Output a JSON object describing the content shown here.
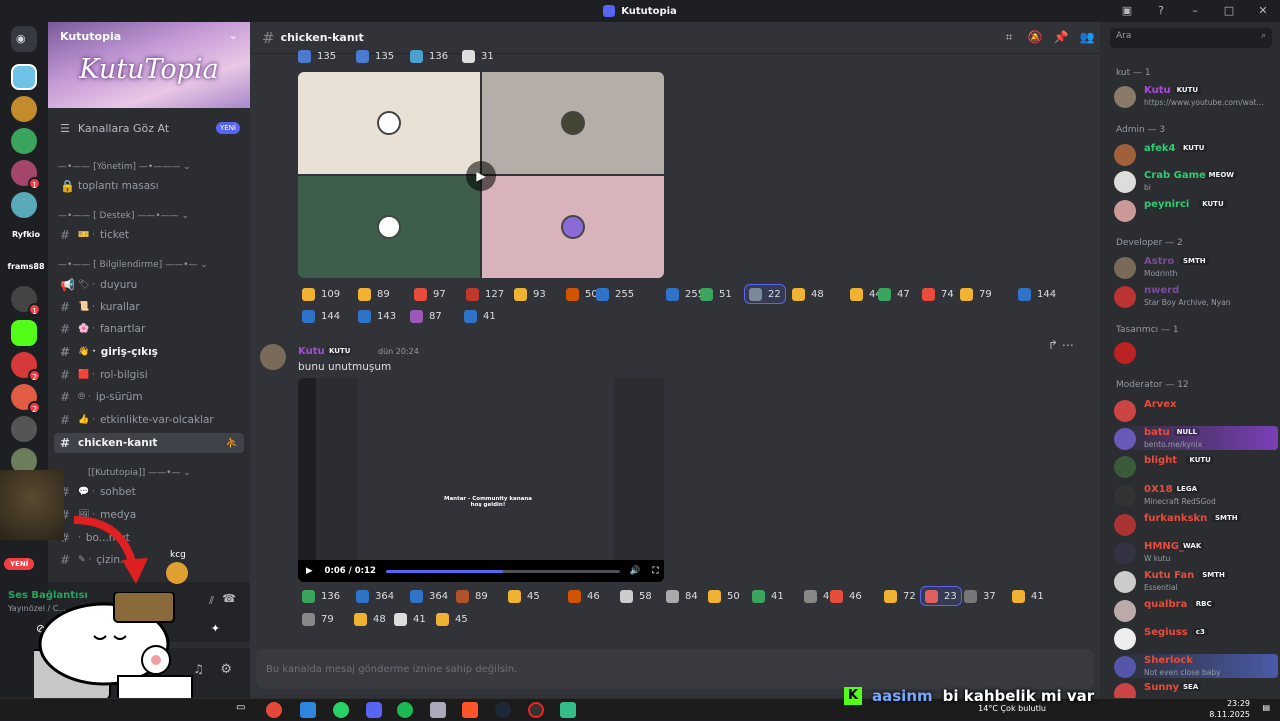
{
  "window": {
    "title": "Kututopia"
  },
  "server": {
    "name": "Kututopia",
    "banner_text": "KutuTopia",
    "browse_label": "Kanallara Göz At",
    "browse_badge": "YENİ"
  },
  "sidebar": {
    "categories": [
      {
        "label": "[Yönetim]"
      },
      {
        "label": "[ Destek]"
      },
      {
        "label": "[ Bilgilendirme]"
      },
      {
        "label": "[Kututopia]"
      }
    ],
    "channels": [
      {
        "label": "toplantı masası"
      },
      {
        "label": "ticket"
      },
      {
        "label": "duyuru"
      },
      {
        "label": "kurallar"
      },
      {
        "label": "fanartlar"
      },
      {
        "label": "giriş-çıkış"
      },
      {
        "label": "rol-bilgisi"
      },
      {
        "label": "ip-sürüm"
      },
      {
        "label": "etkinlikte-var-olcaklar"
      },
      {
        "label": "chicken-kanıt"
      },
      {
        "label": "sohbet"
      },
      {
        "label": "medya"
      },
      {
        "label": "bo...mut"
      },
      {
        "label": "çizin..."
      }
    ],
    "server_labels": [
      "Ryfkio",
      "frams88"
    ],
    "new_badge": "YENİ"
  },
  "voice": {
    "title": "Ses Bağlantısı",
    "sub": "Yayınözel / C..."
  },
  "header": {
    "channel": "chicken-kanıt"
  },
  "reactions_top": [
    "135",
    "135",
    "136",
    "31"
  ],
  "reactions_row1": [
    "109",
    "89",
    "97",
    "127",
    "93",
    "50",
    "255",
    "255",
    "51",
    "22",
    "48",
    "44",
    "47",
    "74",
    "79",
    "144"
  ],
  "reactions_row2": [
    "144",
    "143",
    "87",
    "41"
  ],
  "message": {
    "author": "Kutu",
    "tag": "KUTU",
    "time": "dün 20:24",
    "text": "bunu unutmuşum",
    "video_welcome": "Mantar - Community kanana hoş geldin!",
    "video_time": "0:06 / 0:12",
    "video_progress": 0.5
  },
  "reactions_msg1": [
    "136",
    "364",
    "364",
    "89",
    "45",
    "46",
    "58",
    "84",
    "50",
    "41",
    "45",
    "46",
    "72",
    "23",
    "37",
    "41"
  ],
  "reactions_msg2": [
    "79",
    "48",
    "41",
    "45"
  ],
  "input": {
    "placeholder": "Bu kanalda mesaj gönderme iznine sahip değilsin."
  },
  "search": {
    "placeholder": "Ara"
  },
  "members": {
    "groups": [
      {
        "label": "kut — 1"
      },
      {
        "label": "Admin — 3"
      },
      {
        "label": "Developer — 2"
      },
      {
        "label": "Tasarımcı — 1"
      },
      {
        "label": "Moderator — 12"
      }
    ],
    "list": [
      {
        "name": "Kutu",
        "tag": "KUTU",
        "status": "https://www.youtube.com/wat...",
        "color": "#a64dd6"
      },
      {
        "name": "afek4",
        "tag": "KUTU",
        "status": "",
        "color": "#2ecc71"
      },
      {
        "name": "Crab Game",
        "tag": "MEOW",
        "status": "bi",
        "color": "#2ecc71"
      },
      {
        "name": "peynirci",
        "tag": "KUTU",
        "status": "",
        "color": "#2ecc71"
      },
      {
        "name": "Astro",
        "tag": "SMTH",
        "status": "Modrinth",
        "color": "#7a4d9c"
      },
      {
        "name": "nwerd",
        "tag": "",
        "status": "Star Boy Archive, Nyan",
        "color": "#7a4d9c"
      },
      {
        "name": "",
        "tag": "",
        "status": "",
        "color": "#c0392b"
      },
      {
        "name": "Arvex",
        "tag": "",
        "status": "",
        "color": "#e74c3c"
      },
      {
        "name": "batu",
        "tag": "NULL",
        "status": "bento.me/kynix",
        "color": "#e74c3c"
      },
      {
        "name": "blight",
        "tag": "KUTU",
        "status": "",
        "color": "#e74c3c"
      },
      {
        "name": "0X18",
        "tag": "LEGA",
        "status": "Minecraft RedSGod",
        "color": "#e74c3c"
      },
      {
        "name": "furkankskn",
        "tag": "SMTH",
        "status": "",
        "color": "#e74c3c"
      },
      {
        "name": "HMNG_",
        "tag": "WAK",
        "status": "W kutu",
        "color": "#e74c3c"
      },
      {
        "name": "Kutu Fan",
        "tag": "SMTH",
        "status": "Essential",
        "color": "#e74c3c"
      },
      {
        "name": "qualbra",
        "tag": "RBC",
        "status": "",
        "color": "#e74c3c"
      },
      {
        "name": "Segiuss",
        "tag": "c3",
        "status": "",
        "color": "#e74c3c"
      },
      {
        "name": "Sherlock",
        "tag": "",
        "status": "Not even close baby",
        "color": "#e74c3c"
      },
      {
        "name": "Sunny",
        "tag": "SEA",
        "status": "",
        "color": "#e74c3c"
      }
    ]
  },
  "overlay": {
    "name": "kcg"
  },
  "stream_chat": {
    "user": "aasinm",
    "text": "bi kahbelik mi var"
  },
  "taskbar": {
    "weather": "14°C  Çok bulutlu",
    "time": "23:29",
    "date": "8.11.2025"
  }
}
